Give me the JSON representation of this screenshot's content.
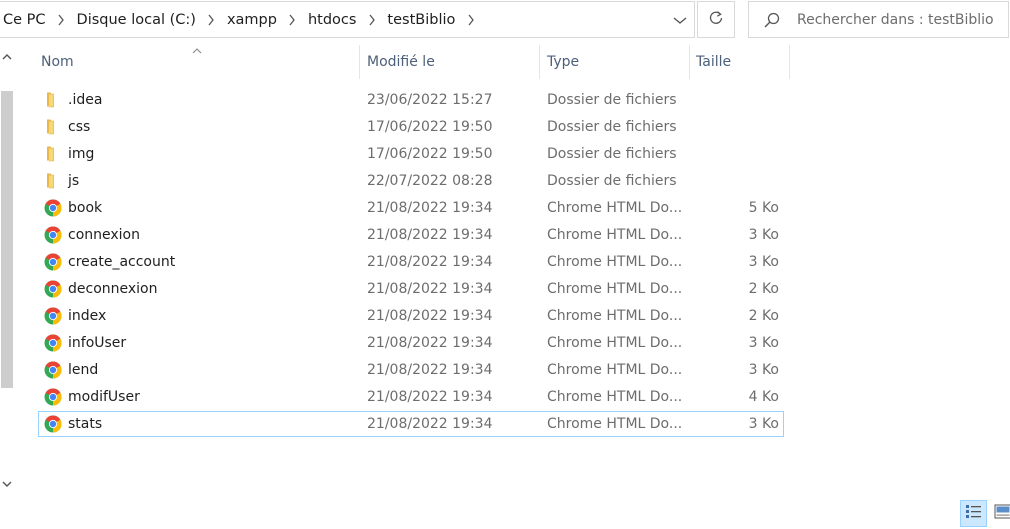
{
  "breadcrumb": [
    "Ce PC",
    "Disque local (C:)",
    "xampp",
    "htdocs",
    "testBiblio"
  ],
  "search": {
    "placeholder": "Rechercher dans : testBiblio",
    "value": ""
  },
  "columns": {
    "name": "Nom",
    "modified": "Modifié le",
    "type": "Type",
    "size": "Taille"
  },
  "files": [
    {
      "icon": "folder-icon",
      "name": ".idea",
      "modified": "23/06/2022 15:27",
      "type": "Dossier de fichiers",
      "size": ""
    },
    {
      "icon": "folder-icon",
      "name": "css",
      "modified": "17/06/2022 19:50",
      "type": "Dossier de fichiers",
      "size": ""
    },
    {
      "icon": "folder-icon",
      "name": "img",
      "modified": "17/06/2022 19:50",
      "type": "Dossier de fichiers",
      "size": ""
    },
    {
      "icon": "folder-icon",
      "name": "js",
      "modified": "22/07/2022 08:28",
      "type": "Dossier de fichiers",
      "size": ""
    },
    {
      "icon": "chrome-icon",
      "name": "book",
      "modified": "21/08/2022 19:34",
      "type": "Chrome HTML Do...",
      "size": "5 Ko"
    },
    {
      "icon": "chrome-icon",
      "name": "connexion",
      "modified": "21/08/2022 19:34",
      "type": "Chrome HTML Do...",
      "size": "3 Ko"
    },
    {
      "icon": "chrome-icon",
      "name": "create_account",
      "modified": "21/08/2022 19:34",
      "type": "Chrome HTML Do...",
      "size": "3 Ko"
    },
    {
      "icon": "chrome-icon",
      "name": "deconnexion",
      "modified": "21/08/2022 19:34",
      "type": "Chrome HTML Do...",
      "size": "2 Ko"
    },
    {
      "icon": "chrome-icon",
      "name": "index",
      "modified": "21/08/2022 19:34",
      "type": "Chrome HTML Do...",
      "size": "2 Ko"
    },
    {
      "icon": "chrome-icon",
      "name": "infoUser",
      "modified": "21/08/2022 19:34",
      "type": "Chrome HTML Do...",
      "size": "3 Ko"
    },
    {
      "icon": "chrome-icon",
      "name": "lend",
      "modified": "21/08/2022 19:34",
      "type": "Chrome HTML Do...",
      "size": "3 Ko"
    },
    {
      "icon": "chrome-icon",
      "name": "modifUser",
      "modified": "21/08/2022 19:34",
      "type": "Chrome HTML Do...",
      "size": "4 Ko"
    },
    {
      "icon": "chrome-icon",
      "name": "stats",
      "modified": "21/08/2022 19:34",
      "type": "Chrome HTML Do...",
      "size": "3 Ko",
      "selected": true
    }
  ],
  "colors": {
    "header_text": "#4c607a",
    "secondary_text": "#6d6d6d",
    "selection_border": "#99d1ff",
    "selection_fill": "#cce8ff",
    "folder": "#f8d775"
  }
}
